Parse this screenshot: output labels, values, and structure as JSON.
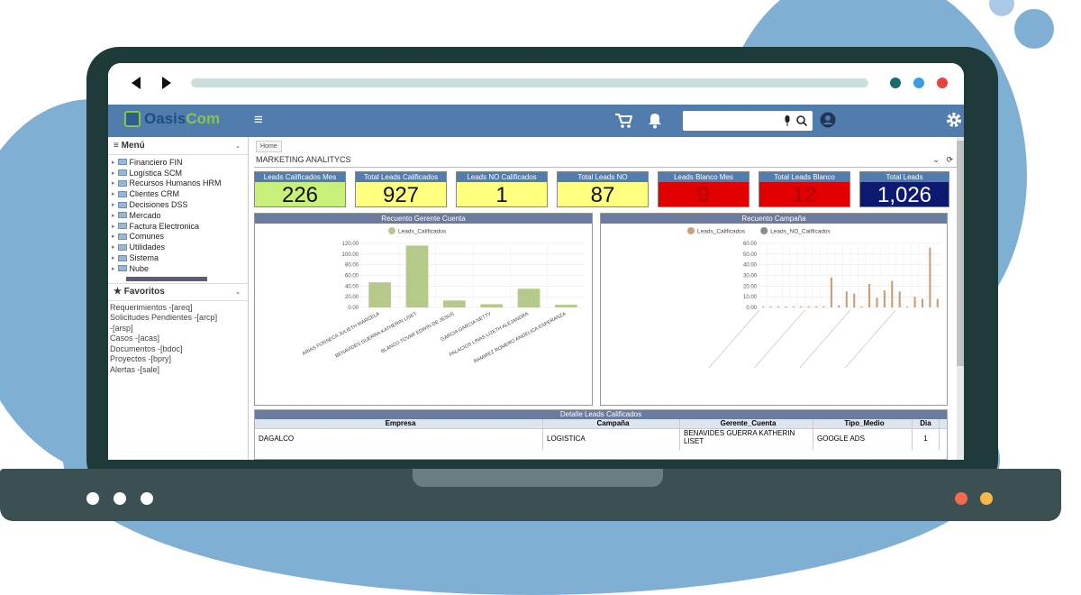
{
  "app": {
    "logo_part1": "Oasis",
    "logo_part2": "Com"
  },
  "topbar": {
    "menu_icon": "hamburger-icon",
    "cart_icon": "cart-icon",
    "bell_icon": "bell-icon",
    "search_placeholder": "",
    "mic_icon": "mic-icon",
    "search_icon": "search-icon",
    "user_icon": "user-icon",
    "settings_icon": "gear-icon"
  },
  "sidebar": {
    "menu_label": "Menú",
    "items": [
      "Financiero FIN",
      "Logística SCM",
      "Recursos Humanos HRM",
      "Clientes CRM",
      "Decisiones DSS",
      "Mercado",
      "Factura Electronica",
      "Comunes",
      "Utilidades",
      "Sistema",
      "Nube"
    ],
    "favorites_label": "Favoritos",
    "favorites": [
      "Requerimientos -[areq]",
      "Solicitudes Pendientes -[arcp]",
      "-[arsp]",
      "Casos -[acas]",
      "Documentos -[bdoc]",
      "Proyectos -[bpry]",
      "Alertas -[sale]"
    ]
  },
  "main": {
    "breadcrumb": "Home",
    "title": "MARKETING ANALITYCS",
    "kpis": [
      {
        "label": "Leads Calificados Mes",
        "value": "226"
      },
      {
        "label": "Total Leads Calificados",
        "value": "927"
      },
      {
        "label": "Leads NO Calificados",
        "value": "1"
      },
      {
        "label": "Total Leads NO",
        "value": "87"
      },
      {
        "label": "Leads Blanco Mes",
        "value": "9"
      },
      {
        "label": "Total Leads Blanco",
        "value": "12"
      },
      {
        "label": "Total Leads",
        "value": "1,026"
      }
    ],
    "kpi_colors": [
      "#c8f07a",
      "#ffff80",
      "#ffff80",
      "#ffff80",
      "#e00000",
      "#e00000",
      "#0c1a70"
    ],
    "kpi_value_colors": [
      "#111111",
      "#111111",
      "#111111",
      "#111111",
      "#b00000",
      "#b00000",
      "#ffffff"
    ],
    "table": {
      "title": "Detalle Leads Calificados",
      "headers": [
        "Empresa",
        "Campaña",
        "Gerente_Cuenta",
        "Tipo_Medio",
        "Dia"
      ],
      "rows": [
        [
          "DAGALCO",
          "LOGISTICA",
          "BENAVIDES GUERRA KATHERIN LISET",
          "GOOGLE ADS",
          "1"
        ]
      ]
    }
  },
  "chart_data": [
    {
      "type": "bar",
      "title": "Recuento Gerente Cuenta",
      "series": [
        {
          "name": "Leads_Calificados",
          "values": [
            47,
            116,
            13,
            6,
            35,
            5
          ]
        }
      ],
      "categories": [
        "ARIAS FONSECA JULIETH MARCELA",
        "BENAVIDES GUERRA KATHERIN LISET",
        "BLANCO TOVAR EDWIN DE JESUS",
        "GARCIA GARCIA NETTY",
        "PALACIOS LINAS LIZETH ALEJANDRA",
        "RAMIREZ ROMERO ANGELICA ESPERANZA"
      ],
      "ylim": [
        0,
        120
      ],
      "yticks": [
        "120.00",
        "100.00",
        "80.00",
        "60.00",
        "40.00",
        "20.00",
        "0.00"
      ],
      "color": "#b5c98a"
    },
    {
      "type": "bar",
      "title": "Recuento Campaña",
      "series": [
        {
          "name": "Leads_Calificados",
          "values": [
            1,
            1,
            1,
            1,
            1,
            1,
            1,
            1,
            1,
            28,
            2,
            15,
            13,
            1,
            22,
            9,
            16,
            25,
            15,
            1,
            10,
            8,
            56,
            8
          ],
          "color": "#c9a07f"
        },
        {
          "name": "Leads_NO_Calificados",
          "values": [
            0,
            0,
            0,
            0,
            0,
            0,
            0,
            0,
            0,
            0,
            0,
            0,
            0,
            0,
            0,
            0,
            0,
            0,
            0,
            0,
            0,
            0,
            0,
            0
          ],
          "color": "#8a8a8a"
        }
      ],
      "ylim": [
        0,
        60
      ],
      "yticks": [
        "60.00",
        "50.00",
        "40.00",
        "30.00",
        "20.00",
        "10.00",
        "0.00"
      ]
    }
  ]
}
